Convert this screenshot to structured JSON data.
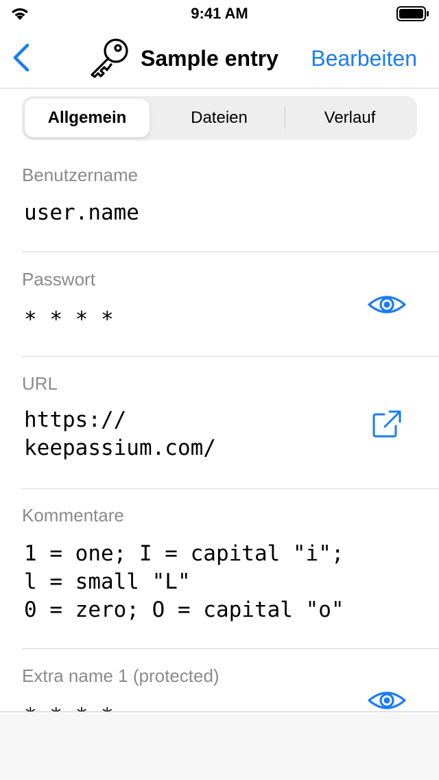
{
  "status_bar": {
    "time": "9:41 AM"
  },
  "nav": {
    "title": "Sample entry",
    "edit_label": "Bearbeiten"
  },
  "tabs": [
    {
      "label": "Allgemein",
      "selected": true
    },
    {
      "label": "Dateien",
      "selected": false
    },
    {
      "label": "Verlauf",
      "selected": false
    }
  ],
  "fields": {
    "username": {
      "label": "Benutzername",
      "value": "user.name"
    },
    "password": {
      "label": "Passwort",
      "value": "* * * *"
    },
    "url": {
      "label": "URL",
      "value": "https://\nkeepassium.com/"
    },
    "comments": {
      "label": "Kommentare",
      "value": "1 = one; I = capital \"i\";\nl = small \"L\"\n0 = zero; O = capital \"o\""
    },
    "extra1": {
      "label": "Extra name 1 (protected)",
      "value": "* * * *"
    }
  },
  "colors": {
    "accent": "#1a7cf5",
    "label_gray": "#8a8a8e",
    "separator": "#d8d8dc"
  }
}
